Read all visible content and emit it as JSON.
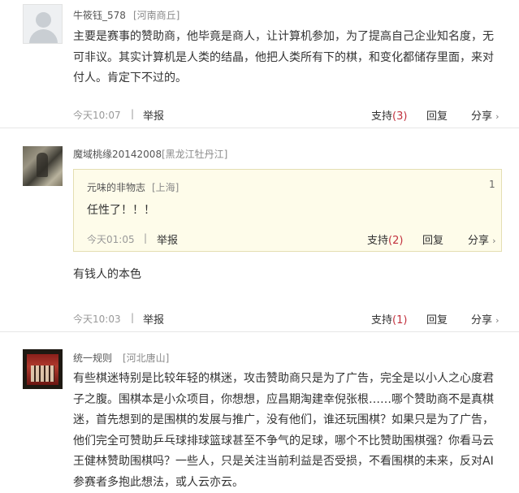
{
  "comments": [
    {
      "user": "牛筱钰_578",
      "location": "[河南商丘]",
      "text_lines": [
        "主要是赛事的赞助商，他毕竟是商人，让计算机参加，为了提高自己企业知名度，无",
        "可非议。其实计算机是人类的结晶，他把人类所有下的棋，和变化都储存里面，来对",
        "付人。肯定下不过的。"
      ],
      "time": "今天10:07",
      "report": "举报",
      "support": "支持",
      "support_count": "(3)",
      "reply": "回复",
      "share": "分享",
      "share_arrow": "›"
    },
    {
      "user": "魔域桃缘20142008",
      "location": "[黑龙江牡丹江]",
      "quote": {
        "user": "元味的非物志",
        "location": "[上海]",
        "floor": "1",
        "text": "任性了！！！",
        "time": "今天01:05",
        "report": "举报",
        "support": "支持",
        "support_count": "(2)",
        "reply": "回复",
        "share": "分享",
        "share_arrow": "›"
      },
      "text": "有钱人的本色",
      "time": "今天10:03",
      "report": "举报",
      "support": "支持",
      "support_count": "(1)",
      "reply": "回复",
      "share": "分享",
      "share_arrow": "›"
    },
    {
      "user": "统一规则",
      "location": "[河北唐山]",
      "text_lines": [
        "有些棋迷特别是比较年轻的棋迷，攻击赞助商只是为了广告，完全是以小人之心度君",
        "子之腹。围棋本是小众项目，你想想，应昌期淘建幸倪张根……哪个赞助商不是真棋",
        "迷，首先想到的是围棋的发展与推广，没有他们，谁还玩围棋？如果只是为了广告，",
        "他们完全可赞助乒乓球排球篮球甚至不争气的足球，哪个不比赞助围棋强？你看马云",
        "王健林赞助围棋吗？一些人，只是关注当前利益是否受损，不看围棋的未来，反对AI",
        "参赛者多抱此想法，或人云亦云。"
      ]
    }
  ],
  "separator": "|"
}
